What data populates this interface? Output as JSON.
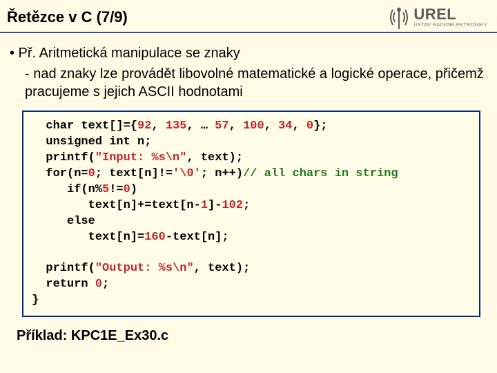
{
  "header": {
    "title": "Řetězce v C (7/9)",
    "logo_name": "UREL",
    "logo_subtitle": "ÚSTAV RADIOELEKTRONIKY"
  },
  "content": {
    "bullet": "• Př. Aritmetická manipulace se znaky",
    "sub": "- nad znaky lze provádět libovolné matematické a logické operace, přičemž pracujeme s jejich ASCII hodnotami"
  },
  "code": {
    "l1a": "  char text[]={",
    "l1b": "92",
    "l1c": ", ",
    "l1d": "135",
    "l1e": ", … ",
    "l1f": "57",
    "l1g": ", ",
    "l1h": "100",
    "l1i": ", ",
    "l1j": "34",
    "l1k": ", ",
    "l1l": "0",
    "l1m": "};",
    "l2": "  unsigned int n;",
    "l3a": "  printf(",
    "l3b": "\"Input: %s\\n\"",
    "l3c": ", text);",
    "l4a": "  for(n=",
    "l4b": "0",
    "l4c": "; text[n]!=",
    "l4d": "'\\0'",
    "l4e": "; n++)",
    "l4f": "// all chars in string",
    "l5a": "     if(n%",
    "l5b": "5",
    "l5c": "!=",
    "l5d": "0",
    "l5e": ")",
    "l6a": "        text[n]+=text[n-",
    "l6b": "1",
    "l6c": "]-",
    "l6d": "102",
    "l6e": ";",
    "l7": "     else",
    "l8a": "        text[n]=",
    "l8b": "160",
    "l8c": "-text[n];",
    "blank": "",
    "l9a": "  printf(",
    "l9b": "\"Output: %s\\n\"",
    "l9c": ", text);",
    "l10a": "  return ",
    "l10b": "0",
    "l10c": ";",
    "l11": "}"
  },
  "example_label": "Příklad: KPC1E_Ex30.c"
}
